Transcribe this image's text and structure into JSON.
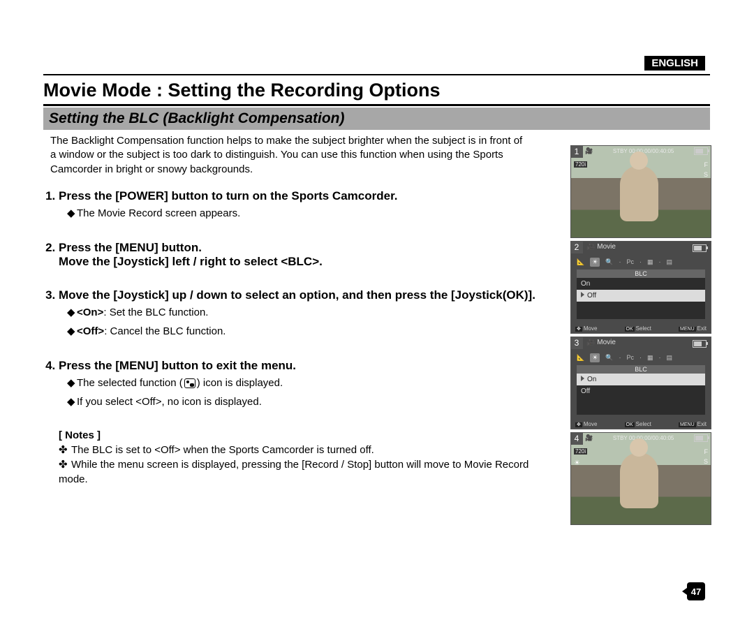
{
  "language": "ENGLISH",
  "title": "Movie Mode : Setting the Recording Options",
  "subtitle": "Setting the BLC (Backlight Compensation)",
  "intro": "The Backlight Compensation function helps to make the subject brighter when the subject is in front of a window or the subject is too dark to distinguish. You can use this function when using the Sports Camcorder in bright or snowy backgrounds.",
  "steps": {
    "s1": {
      "head": "Press the [POWER] button to turn on the Sports Camcorder.",
      "sub1": "The Movie Record screen appears."
    },
    "s2": {
      "headA": "Press the [MENU] button.",
      "headB": "Move the [Joystick] left / right to select <BLC>."
    },
    "s3": {
      "head": "Move the [Joystick] up / down to select an option, and then press the [Joystick(OK)].",
      "sub1a": "<On>",
      "sub1b": ": Set the BLC function.",
      "sub2a": "<Off>",
      "sub2b": ": Cancel the BLC function."
    },
    "s4": {
      "head": "Press the [MENU] button to exit the menu.",
      "sub1a": "The selected function (",
      "sub1b": ") icon is displayed.",
      "sub2": "If you select <Off>, no icon is displayed."
    }
  },
  "notes": {
    "head": "[ Notes ]",
    "n1": "The BLC is set to <Off> when the Sports Camcorder is turned off.",
    "n2": "While the menu screen is displayed, pressing the [Record / Stop] button will move to Movie Record mode."
  },
  "shots": {
    "s1": {
      "num": "1",
      "stby": "STBY 00:00:00/00:40:05",
      "res": "720i",
      "iconF": "F",
      "iconS": "S"
    },
    "s2": {
      "num": "2",
      "title": "Movie",
      "section": "BLC",
      "opt1": "On",
      "opt2": "Off",
      "footMove": "Move",
      "footSelect": "Select",
      "footExit": "Exit",
      "menu": "MENU",
      "ok": "OK"
    },
    "s3": {
      "num": "3",
      "title": "Movie",
      "section": "BLC",
      "opt1": "On",
      "opt2": "Off",
      "footMove": "Move",
      "footSelect": "Select",
      "footExit": "Exit",
      "menu": "MENU",
      "ok": "OK"
    },
    "s4": {
      "num": "4",
      "stby": "STBY 00:00:00/00:40:05",
      "res": "720i",
      "iconF": "F",
      "iconS": "S"
    }
  },
  "pageNumber": "47"
}
